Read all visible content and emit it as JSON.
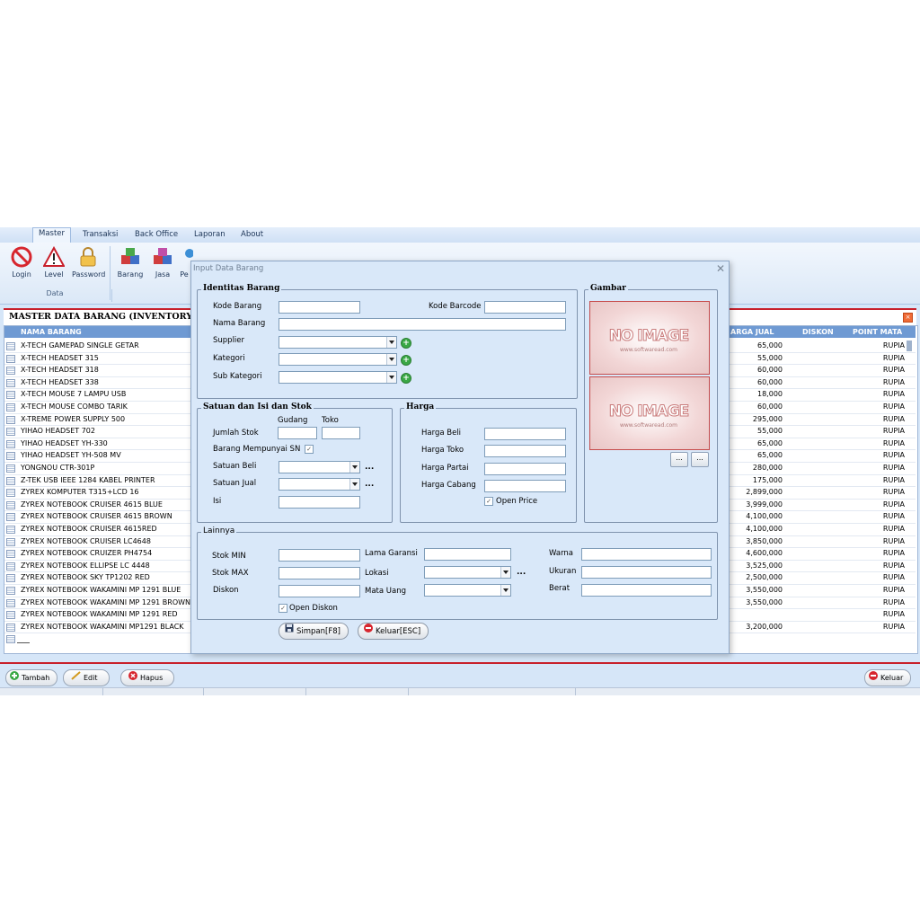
{
  "menu": {
    "items": [
      "Master",
      "Transaksi",
      "Back Office",
      "Laporan",
      "About"
    ]
  },
  "ribbon": {
    "buttons": [
      "Login",
      "Level",
      "Password",
      "Barang",
      "Jasa",
      "Pe"
    ],
    "group_label": "Data"
  },
  "master": {
    "title": "MASTER DATA BARANG (INVENTORY)",
    "columns": {
      "nama": "NAMA BARANG",
      "harga_jual": "ARGA JUAL",
      "diskon": "DISKON",
      "point": "POINT MATA"
    },
    "rows": [
      {
        "name": "X-TECH GAMEPAD SINGLE GETAR",
        "price": "65,000",
        "cur": "RUPIA"
      },
      {
        "name": "X-TECH HEADSET 315",
        "price": "55,000",
        "cur": "RUPIA"
      },
      {
        "name": "X-TECH HEADSET 318",
        "price": "60,000",
        "cur": "RUPIA"
      },
      {
        "name": "X-TECH HEADSET 338",
        "price": "60,000",
        "cur": "RUPIA"
      },
      {
        "name": "X-TECH MOUSE 7 LAMPU USB",
        "price": "18,000",
        "cur": "RUPIA"
      },
      {
        "name": "X-TECH MOUSE COMBO TARIK",
        "price": "60,000",
        "cur": "RUPIA"
      },
      {
        "name": "X-TREME POWER SUPPLY 500",
        "price": "295,000",
        "cur": "RUPIA"
      },
      {
        "name": "YIHAO HEADSET 702",
        "price": "55,000",
        "cur": "RUPIA"
      },
      {
        "name": "YIHAO HEADSET YH-330",
        "price": "65,000",
        "cur": "RUPIA"
      },
      {
        "name": "YIHAO HEADSET YH-508 MV",
        "price": "65,000",
        "cur": "RUPIA"
      },
      {
        "name": "YONGNOU CTR-301P",
        "price": "280,000",
        "cur": "RUPIA"
      },
      {
        "name": "Z-TEK USB IEEE 1284 KABEL PRINTER",
        "price": "175,000",
        "cur": "RUPIA"
      },
      {
        "name": "ZYREX KOMPUTER T315+LCD 16",
        "price": "2,899,000",
        "cur": "RUPIA"
      },
      {
        "name": "ZYREX NOTEBOOK CRUISER 4615 BLUE",
        "price": "3,999,000",
        "cur": "RUPIA"
      },
      {
        "name": "ZYREX NOTEBOOK CRUISER 4615 BROWN",
        "price": "4,100,000",
        "cur": "RUPIA"
      },
      {
        "name": "ZYREX NOTEBOOK CRUISER 4615RED",
        "price": "4,100,000",
        "cur": "RUPIA"
      },
      {
        "name": "ZYREX NOTEBOOK CRUISER LC4648",
        "price": "3,850,000",
        "cur": "RUPIA"
      },
      {
        "name": "ZYREX NOTEBOOK CRUIZER PH4754",
        "price": "4,600,000",
        "cur": "RUPIA"
      },
      {
        "name": "ZYREX NOTEBOOK ELLIPSE LC 4448",
        "price": "3,525,000",
        "cur": "RUPIA"
      },
      {
        "name": "ZYREX NOTEBOOK SKY TP1202 RED",
        "price": "2,500,000",
        "cur": "RUPIA"
      },
      {
        "name": "ZYREX NOTEBOOK WAKAMINI MP 1291 BLUE",
        "price": "3,550,000",
        "cur": "RUPIA"
      },
      {
        "name": "ZYREX NOTEBOOK WAKAMINI MP 1291 BROWN",
        "price": "3,550,000",
        "cur": "RUPIA"
      },
      {
        "name": "ZYREX NOTEBOOK WAKAMINI MP 1291 RED",
        "price": "",
        "cur": "RUPIA"
      },
      {
        "name": "ZYREX NOTEBOOK WAKAMINI MP1291 BLACK",
        "price": "3,200,000",
        "cur": "RUPIA"
      }
    ]
  },
  "bottom": {
    "tambah": "Tambah",
    "edit": "Edit",
    "hapus": "Hapus",
    "keluar": "Keluar"
  },
  "dialog": {
    "title": "Input Data Barang",
    "identitas": {
      "legend": "Identitas Barang",
      "kode_barang": "Kode Barang",
      "kode_barcode": "Kode Barcode",
      "nama_barang": "Nama Barang",
      "supplier": "Supplier",
      "kategori": "Kategori",
      "sub_kategori": "Sub Kategori"
    },
    "gambar": {
      "legend": "Gambar",
      "noimage": "NO IMAGE",
      "noimage_sub": "www.softwaread.com",
      "browse": "..."
    },
    "satuan": {
      "legend": "Satuan dan Isi dan Stok",
      "gudang": "Gudang",
      "toko": "Toko",
      "jumlah_stok": "Jumlah Stok",
      "sn": "Barang Mempunyai SN",
      "satuan_beli": "Satuan Beli",
      "satuan_jual": "Satuan Jual",
      "isi": "Isi",
      "more": "..."
    },
    "harga": {
      "legend": "Harga",
      "beli": "Harga Beli",
      "toko": "Harga Toko",
      "partai": "Harga Partai",
      "cabang": "Harga Cabang",
      "open_price": "Open Price"
    },
    "lainnya": {
      "legend": "Lainnya",
      "stok_min": "Stok MIN",
      "stok_max": "Stok MAX",
      "diskon": "Diskon",
      "open_diskon": "Open Diskon",
      "lama_garansi": "Lama Garansi",
      "lokasi": "Lokasi",
      "mata_uang": "Mata Uang",
      "warna": "Warna",
      "ukuran": "Ukuran",
      "berat": "Berat",
      "more": "..."
    },
    "simpan": "Simpan[F8]",
    "keluar": "Keluar[ESC]"
  }
}
